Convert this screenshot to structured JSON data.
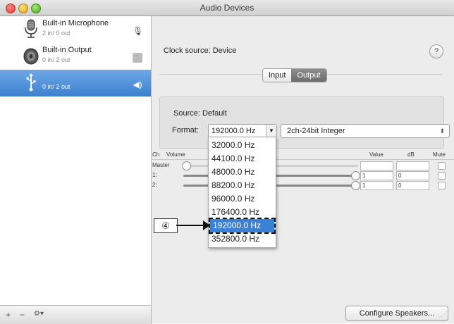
{
  "window": {
    "title": "Audio Devices"
  },
  "sidebar": {
    "devices": [
      {
        "name": "Built-in Microphone",
        "io": "2 in/ 0 out",
        "icon": "microphone-icon",
        "status_icon": "microphone-small-icon",
        "selected": false
      },
      {
        "name": "Built-in Output",
        "io": "0 in/ 2 out",
        "icon": "speaker-icon",
        "status_icon": "speaker-small-icon",
        "selected": false
      },
      {
        "name": "",
        "io": "0 in/ 2 out",
        "icon": "usb-icon",
        "status_icon": "volume-icon",
        "selected": true
      }
    ],
    "bottom": {
      "add": "+",
      "remove": "−",
      "gear": "⚙▾"
    }
  },
  "detail": {
    "clock_source": "Clock source: Device",
    "help": "?",
    "tabs": [
      "Input",
      "Output"
    ],
    "active_tab": "Output",
    "source": "Source: Default",
    "format_label": "Format:",
    "format_value": "192000.0 Hz",
    "bit_format": "2ch-24bit Integer"
  },
  "channels": {
    "headers": {
      "ch": "Ch",
      "volume": "Volume",
      "value": "Value",
      "db": "dB",
      "mute": "Mute"
    },
    "rows": [
      {
        "label": "Master",
        "value": "",
        "db": "",
        "level": 0.0,
        "enabled": false
      },
      {
        "label": "1:",
        "value": "1",
        "db": "0",
        "level": 1.0,
        "enabled": true
      },
      {
        "label": "2:",
        "value": "1",
        "db": "0",
        "level": 1.0,
        "enabled": true
      }
    ]
  },
  "dropdown": {
    "options": [
      "32000.0 Hz",
      "44100.0 Hz",
      "48000.0 Hz",
      "88200.0 Hz",
      "96000.0 Hz",
      "176400.0 Hz",
      "192000.0 Hz",
      "352800.0 Hz"
    ],
    "highlighted": "192000.0 Hz"
  },
  "annotation": {
    "label": "④"
  },
  "footer": {
    "configure": "Configure Speakers..."
  },
  "colors": {
    "selection": "#3c7fd0",
    "highlight": "#3b82d6"
  }
}
